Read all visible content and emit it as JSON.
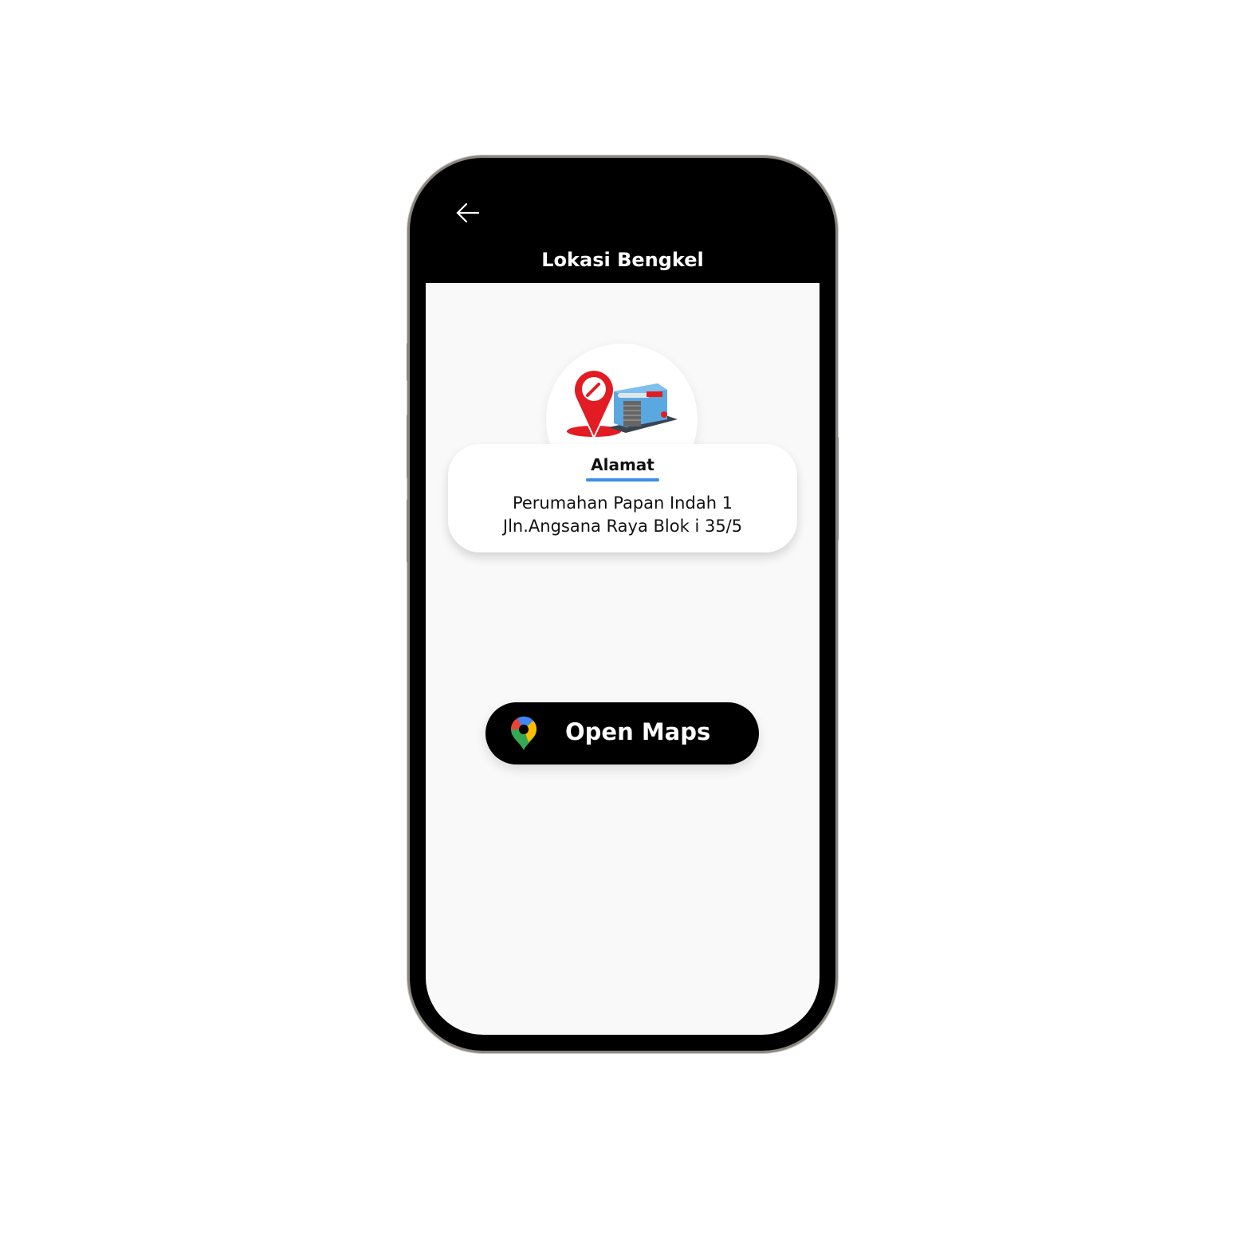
{
  "header": {
    "title": "Lokasi Bengkel",
    "back_icon": "arrow-left-icon"
  },
  "address_card": {
    "label": "Alamat",
    "line1": "Perumahan Papan Indah 1",
    "line2": "Jln.Angsana Raya Blok i 35/5",
    "accent": "#3b8fe6"
  },
  "open_maps": {
    "label": "Open Maps",
    "icon": "google-maps-icon"
  }
}
